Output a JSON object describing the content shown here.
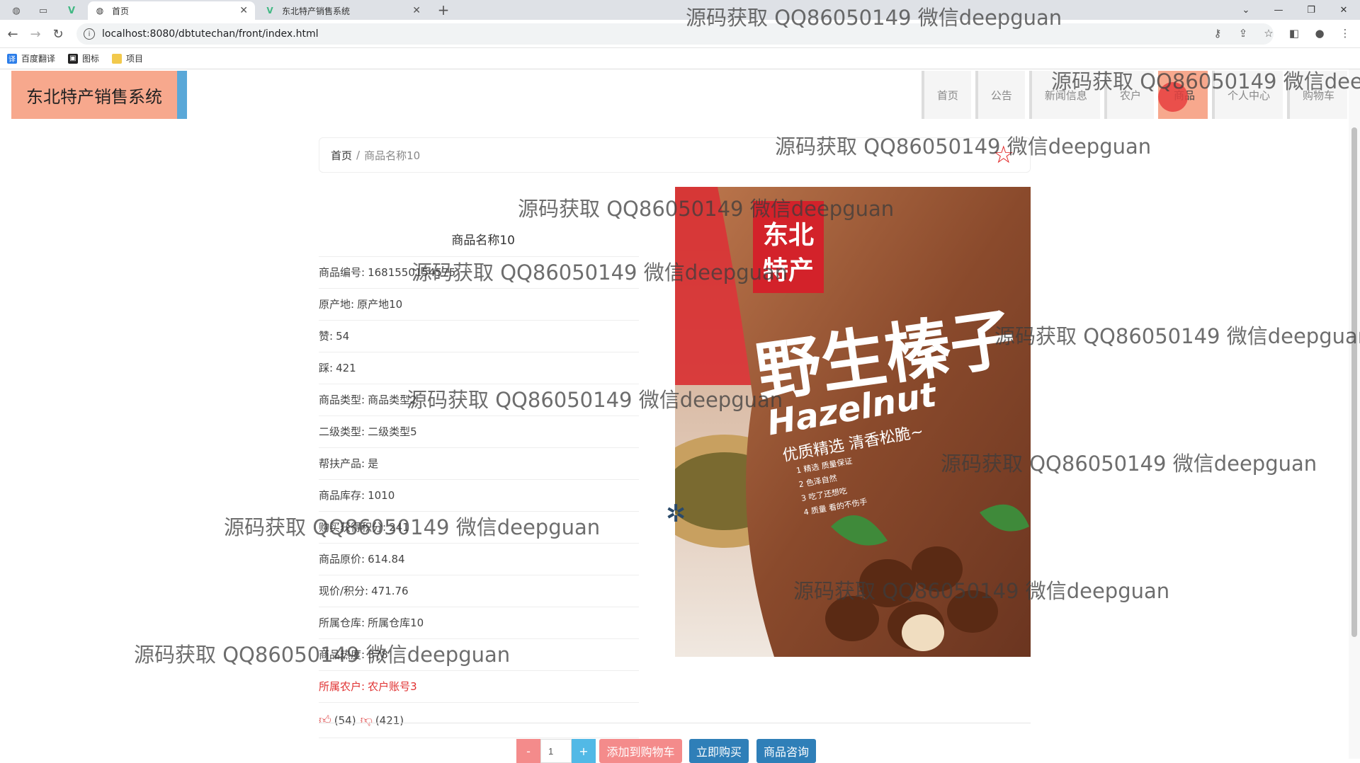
{
  "browser": {
    "tabs": [
      {
        "title": "首页",
        "active": true
      },
      {
        "title": "东北特产销售系统",
        "active": false
      }
    ],
    "url": "localhost:8080/dbtutechan/front/index.html",
    "bookmarks": [
      "百度翻译",
      "图标",
      "项目"
    ]
  },
  "site": {
    "logo": "东北特产销售系统",
    "nav": [
      "首页",
      "公告",
      "新闻信息",
      "农户",
      "商品",
      "个人中心",
      "购物车"
    ],
    "active_nav": "商品"
  },
  "breadcrumb": {
    "home": "首页",
    "sep": "/",
    "current": "商品名称10"
  },
  "product": {
    "title": "商品名称10",
    "rows": [
      {
        "label": "商品编号:",
        "value": "1681550154575"
      },
      {
        "label": "原产地:",
        "value": "原产地10"
      },
      {
        "label": "赞:",
        "value": "54"
      },
      {
        "label": "踩:",
        "value": "421"
      },
      {
        "label": "商品类型:",
        "value": "商品类型2"
      },
      {
        "label": "二级类型:",
        "value": "二级类型5"
      },
      {
        "label": "帮扶产品:",
        "value": "是"
      },
      {
        "label": "商品库存:",
        "value": "1010"
      },
      {
        "label": "购买获得积分:",
        "value": "241"
      },
      {
        "label": "商品原价:",
        "value": "614.84"
      },
      {
        "label": "现价/积分:",
        "value": "471.76"
      },
      {
        "label": "所属仓库:",
        "value": "所属仓库10"
      },
      {
        "label": "商品热度:",
        "value": "378"
      },
      {
        "label": "所属农户:",
        "value": "农户账号3"
      }
    ],
    "likes": "(54)",
    "dislikes": "(421)"
  },
  "image": {
    "brand_top": "东北",
    "brand_bottom": "特产",
    "name_cn": "野生榛子",
    "name_en": "Hazelnut",
    "slogan": "优质精选 清香松脆~",
    "features": [
      "1 精选 质量保证",
      "2 色泽自然",
      "3 吃了还想吃",
      "4 质量 看的不伤手"
    ]
  },
  "purchase": {
    "minus": "-",
    "quantity": "1",
    "plus": "+",
    "add_to_cart": "添加到购物车",
    "buy_now": "立即购买",
    "consult": "商品咨询"
  },
  "watermark_text": "源码获取 QQ86050149 微信deepguan"
}
